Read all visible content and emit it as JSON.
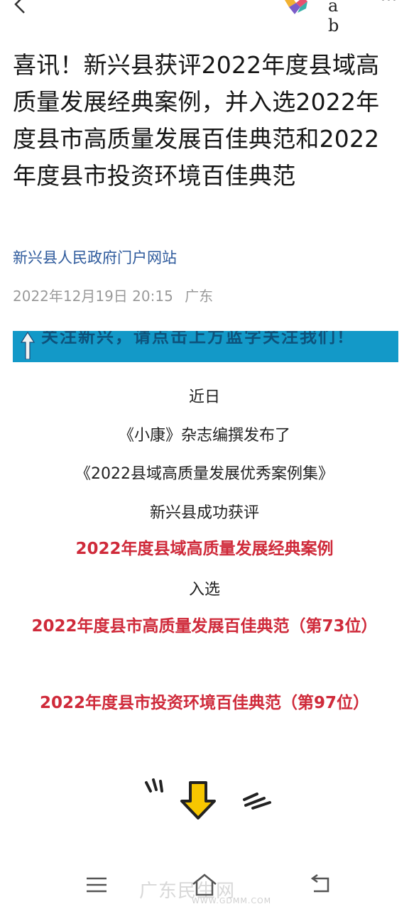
{
  "topbar": {
    "back_icon": "chevron-left-icon",
    "logo_icon": "colorful-diamond-logo-icon",
    "font_size_label": "a b",
    "more_label": "···"
  },
  "article": {
    "title": "喜讯！新兴县获评2022年度县域高质量发展经典案例，并入选2022年度县市高质量发展百佳典范和2022年度县市投资环境百佳典范",
    "source": "新兴县人民政府门户网站",
    "date": "2022年12月19日 20:15",
    "location": "广东",
    "banner_text": "关注新兴，请点击上方蓝字关注我们！",
    "body": {
      "line1": "近日",
      "line2": "《小康》杂志编撰发布了",
      "line3": "《2022县域高质量发展优秀案例集》",
      "line4": "新兴县成功获评",
      "highlight1": "2022年度县域高质量发展经典案例",
      "line5": "入选",
      "highlight2": "2022年度县市高质量发展百佳典范（第73位）",
      "highlight3": "2022年度县市投资环境百佳典范（第97位）"
    },
    "doodle_icon": "yellow-down-arrow-icon"
  },
  "colors": {
    "highlight": "#cf2a3a",
    "source_link": "#2e5a9c",
    "banner": "#1399c8",
    "arrow_yellow": "#f7c600"
  },
  "navbar": {
    "menu_icon": "menu-icon",
    "home_icon": "home-icon",
    "back_icon": "back-icon"
  },
  "watermark": {
    "text": "广东民生网",
    "url": "WWW.GDMM.COM"
  }
}
